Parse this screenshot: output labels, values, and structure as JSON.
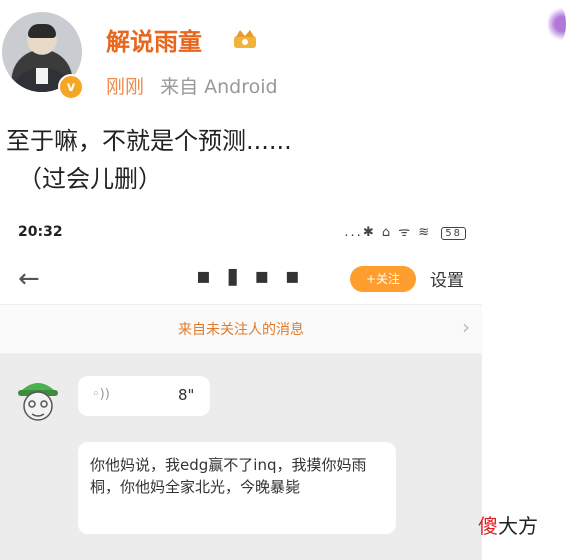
{
  "post": {
    "username": "解说雨童",
    "time": "刚刚",
    "source": "来自 Android",
    "text_line1": "至于嘛，不就是个预测......",
    "text_line2": "（过会儿删）"
  },
  "screenshot": {
    "status_time": "20:32",
    "status_icons": "...✱ ⌂ ᯤ ≋",
    "battery": "58",
    "chat_title": "▪ ▮ ▪ ▪",
    "follow_button": "+关注",
    "settings": "设置",
    "notice": "来自未关注人的消息",
    "voice_duration": "8\"",
    "message_text": "你他妈说，我edg赢不了inq，我摸你妈雨桐，你他妈全家北光，今晚暴毙"
  },
  "watermark": {
    "first": "傻",
    "rest": "大方"
  },
  "colors": {
    "username": "#e8671c",
    "follow": "#ff9d2e",
    "notice": "#e07b2a"
  }
}
